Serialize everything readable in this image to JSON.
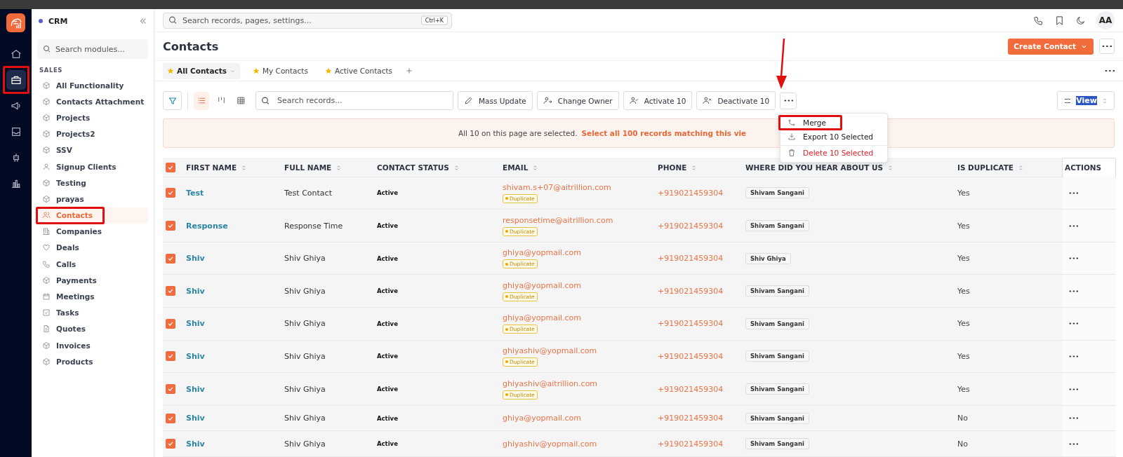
{
  "rail": [
    {
      "kind": "home",
      "selected": false,
      "highlighted": false
    },
    {
      "kind": "briefcase",
      "selected": true,
      "highlighted": true
    },
    {
      "kind": "megaphone",
      "selected": false,
      "highlighted": false
    },
    {
      "kind": "inbox",
      "selected": false,
      "highlighted": false
    },
    {
      "kind": "robot",
      "selected": false,
      "highlighted": false
    },
    {
      "kind": "chart",
      "selected": false,
      "highlighted": false
    }
  ],
  "sidebar": {
    "title": "CRM",
    "search": {
      "placeholder": "Search modules..."
    },
    "section": "SALES",
    "items": [
      {
        "label": "All Functionality",
        "kind": "module",
        "selected": false,
        "highlighted": false
      },
      {
        "label": "Contacts Attachment",
        "kind": "module",
        "selected": false,
        "highlighted": false
      },
      {
        "label": "Projects",
        "kind": "module",
        "selected": false,
        "highlighted": false
      },
      {
        "label": "Projects2",
        "kind": "module",
        "selected": false,
        "highlighted": false
      },
      {
        "label": "SSV",
        "kind": "module",
        "selected": false,
        "highlighted": false
      },
      {
        "label": "Signup Clients",
        "kind": "person",
        "selected": false,
        "highlighted": false
      },
      {
        "label": "Testing",
        "kind": "module",
        "selected": false,
        "highlighted": false
      },
      {
        "label": "prayas",
        "kind": "module",
        "selected": false,
        "highlighted": false
      },
      {
        "label": "Contacts",
        "kind": "people",
        "selected": true,
        "highlighted": true
      },
      {
        "label": "Companies",
        "kind": "building",
        "selected": false,
        "highlighted": false
      },
      {
        "label": "Deals",
        "kind": "heart",
        "selected": false,
        "highlighted": false
      },
      {
        "label": "Calls",
        "kind": "phone",
        "selected": false,
        "highlighted": false
      },
      {
        "label": "Payments",
        "kind": "module",
        "selected": false,
        "highlighted": false
      },
      {
        "label": "Meetings",
        "kind": "calendar",
        "selected": false,
        "highlighted": false
      },
      {
        "label": "Tasks",
        "kind": "task",
        "selected": false,
        "highlighted": false
      },
      {
        "label": "Quotes",
        "kind": "doc",
        "selected": false,
        "highlighted": false
      },
      {
        "label": "Invoices",
        "kind": "module",
        "selected": false,
        "highlighted": false
      },
      {
        "label": "Products",
        "kind": "module",
        "selected": false,
        "highlighted": false
      }
    ]
  },
  "topbar": {
    "search": {
      "placeholder": "Search records, pages, settings...",
      "shortcut": "Ctrl+K"
    },
    "avatar": "AA"
  },
  "page": {
    "title": "Contacts",
    "create_button": "Create Contact"
  },
  "views": [
    {
      "label": "All Contacts",
      "selected": true
    },
    {
      "label": "My Contacts",
      "selected": false
    },
    {
      "label": "Active Contacts",
      "selected": false
    }
  ],
  "toolbar": {
    "layouts": [
      {
        "kind": "list",
        "selected": true
      },
      {
        "kind": "kanban",
        "selected": false
      },
      {
        "kind": "grid",
        "selected": false
      }
    ],
    "search": {
      "placeholder": "Search records..."
    },
    "actions": [
      {
        "label": "Mass Update",
        "kind": "edit"
      },
      {
        "label": "Change Owner",
        "kind": "owner"
      },
      {
        "label": "Activate 10",
        "kind": "activate"
      },
      {
        "label": "Deactivate 10",
        "kind": "deactivate"
      }
    ],
    "view_button": "View"
  },
  "menu": [
    {
      "label": "Merge",
      "kind": "merge",
      "highlighted": true
    },
    {
      "label": "Export 10 Selected",
      "kind": "export",
      "highlighted": false
    },
    {
      "label": "Delete 10 Selected",
      "kind": "delete",
      "highlighted": false
    }
  ],
  "banner": {
    "text": "All 10 on this page are selected.",
    "link": "Select all 100 records matching this vie"
  },
  "table": {
    "all_checked": true,
    "columns": [
      "FIRST NAME",
      "FULL NAME",
      "CONTACT STATUS",
      "EMAIL",
      "PHONE",
      "WHERE DID YOU HEAR ABOUT US",
      "IS DUPLICATE",
      "ACTIONS"
    ],
    "rows": [
      {
        "checked": true,
        "first_name": "Test",
        "full_name": "Test Contact",
        "status": "Active",
        "email": "shivam.s+07@aitrillion.com",
        "badge": "Duplicate",
        "phone": "+919021459304",
        "source": "Shivam Sangani",
        "is_duplicate": "Yes"
      },
      {
        "checked": true,
        "first_name": "Response",
        "full_name": "Response Time",
        "status": "Active",
        "email": "responsetime@aitrillion.com",
        "badge": "Duplicate",
        "phone": "+919021459304",
        "source": "Shivam Sangani",
        "is_duplicate": "Yes"
      },
      {
        "checked": true,
        "first_name": "Shiv",
        "full_name": "Shiv Ghiya",
        "status": "Active",
        "email": "ghiya@yopmail.com",
        "badge": "Duplicate",
        "phone": "+919021459304",
        "source": "Shiv Ghiya",
        "is_duplicate": "Yes"
      },
      {
        "checked": true,
        "first_name": "Shiv",
        "full_name": "Shiv Ghiya",
        "status": "Active",
        "email": "ghiya@yopmail.com",
        "badge": "Duplicate",
        "phone": "+919021459304",
        "source": "Shivam Sangani",
        "is_duplicate": "Yes"
      },
      {
        "checked": true,
        "first_name": "Shiv",
        "full_name": "Shiv Ghiya",
        "status": "Active",
        "email": "ghiya@yopmail.com",
        "badge": "Duplicate",
        "phone": "+919021459304",
        "source": "Shivam Sangani",
        "is_duplicate": "Yes"
      },
      {
        "checked": true,
        "first_name": "Shiv",
        "full_name": "Shiv Ghiya",
        "status": "Active",
        "email": "ghiyashiv@yopmail.com",
        "badge": "Duplicate",
        "phone": "+919021459304",
        "source": "Shivam Sangani",
        "is_duplicate": "Yes"
      },
      {
        "checked": true,
        "first_name": "Shiv",
        "full_name": "Shiv Ghiya",
        "status": "Active",
        "email": "ghiyashiv@aitrillion.com",
        "badge": "Duplicate",
        "phone": "+919021459304",
        "source": "Shivam Sangani",
        "is_duplicate": "Yes"
      },
      {
        "checked": true,
        "first_name": "Shiv",
        "full_name": "Shiv Ghiya",
        "status": "Active",
        "email": "ghiya@yopmail.com",
        "phone": "+919021459304",
        "source": "Shivam Sangani",
        "is_duplicate": "No"
      },
      {
        "checked": true,
        "first_name": "Shiv",
        "full_name": "Shiv Ghiya",
        "status": "Active",
        "email": "ghiyashiv@yopmail.com",
        "phone": "+919021459304",
        "source": "Shivam Sangani",
        "is_duplicate": "No"
      }
    ]
  }
}
